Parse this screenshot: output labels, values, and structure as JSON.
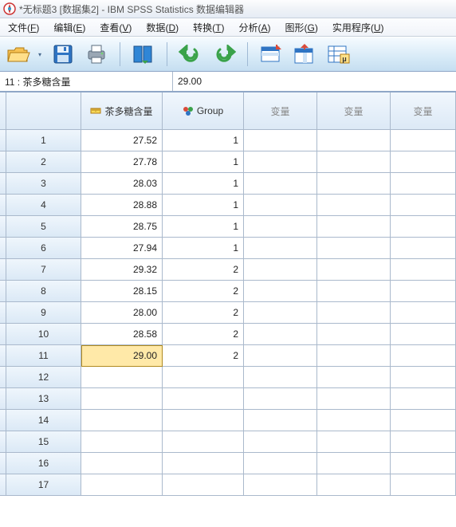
{
  "window": {
    "title": "*无标题3 [数据集2] - IBM SPSS Statistics 数据编辑器"
  },
  "menu": {
    "file": {
      "label": "文件",
      "key": "F"
    },
    "edit": {
      "label": "编辑",
      "key": "E"
    },
    "view": {
      "label": "查看",
      "key": "V"
    },
    "data": {
      "label": "数据",
      "key": "D"
    },
    "transform": {
      "label": "转换",
      "key": "T"
    },
    "analyze": {
      "label": "分析",
      "key": "A"
    },
    "graphs": {
      "label": "图形",
      "key": "G"
    },
    "utilities": {
      "label": "实用程序",
      "key": "U"
    }
  },
  "celledit": {
    "ref": "11 : 茶多糖含量",
    "value": "29.00"
  },
  "columns": {
    "c1": {
      "label": "茶多糖含量",
      "type": "scale"
    },
    "c2": {
      "label": "Group",
      "type": "nominal"
    },
    "c3": {
      "label": "变量",
      "type": "empty"
    },
    "c4": {
      "label": "变量",
      "type": "empty"
    },
    "c5": {
      "label": "变量",
      "type": "empty"
    }
  },
  "selected": {
    "row": 11,
    "col": "c1"
  },
  "rows": [
    {
      "n": "1",
      "c1": "27.52",
      "c2": "1"
    },
    {
      "n": "2",
      "c1": "27.78",
      "c2": "1"
    },
    {
      "n": "3",
      "c1": "28.03",
      "c2": "1"
    },
    {
      "n": "4",
      "c1": "28.88",
      "c2": "1"
    },
    {
      "n": "5",
      "c1": "28.75",
      "c2": "1"
    },
    {
      "n": "6",
      "c1": "27.94",
      "c2": "1"
    },
    {
      "n": "7",
      "c1": "29.32",
      "c2": "2"
    },
    {
      "n": "8",
      "c1": "28.15",
      "c2": "2"
    },
    {
      "n": "9",
      "c1": "28.00",
      "c2": "2"
    },
    {
      "n": "10",
      "c1": "28.58",
      "c2": "2"
    },
    {
      "n": "11",
      "c1": "29.00",
      "c2": "2"
    },
    {
      "n": "12",
      "c1": "",
      "c2": ""
    },
    {
      "n": "13",
      "c1": "",
      "c2": ""
    },
    {
      "n": "14",
      "c1": "",
      "c2": ""
    },
    {
      "n": "15",
      "c1": "",
      "c2": ""
    },
    {
      "n": "16",
      "c1": "",
      "c2": ""
    },
    {
      "n": "17",
      "c1": "",
      "c2": ""
    }
  ]
}
